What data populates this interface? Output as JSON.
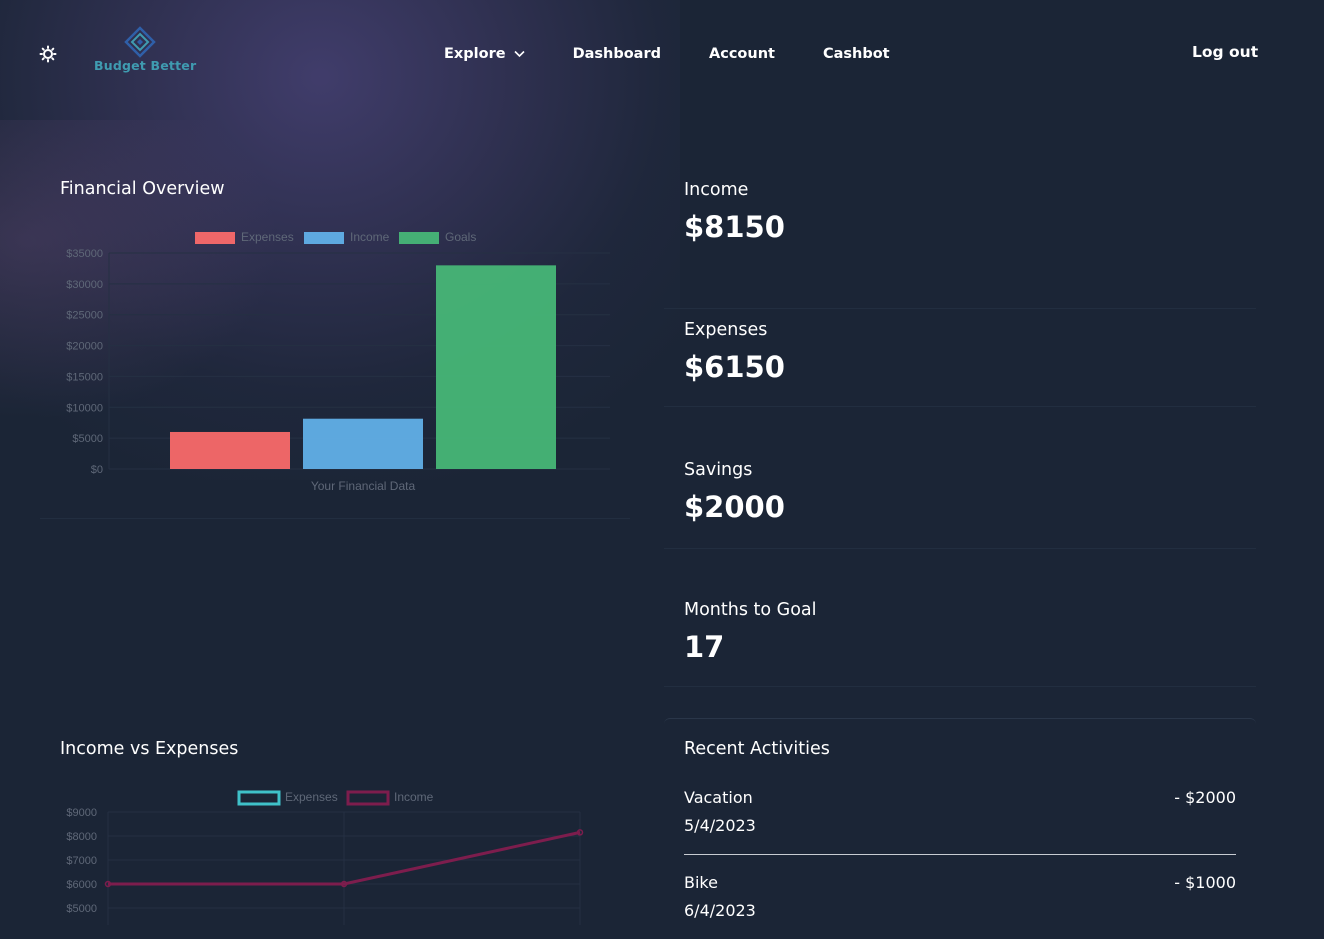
{
  "app": {
    "logo_text": "Budget Better"
  },
  "nav": {
    "explore": "Explore",
    "dashboard": "Dashboard",
    "account": "Account",
    "cashbot": "Cashbot",
    "logout": "Log out"
  },
  "financial_overview": {
    "title": "Financial Overview"
  },
  "income_vs_expenses": {
    "title": "Income vs Expenses"
  },
  "stats": {
    "income": {
      "label": "Income",
      "value": "$8150"
    },
    "expenses": {
      "label": "Expenses",
      "value": "$6150"
    },
    "savings": {
      "label": "Savings",
      "value": "$2000"
    },
    "months": {
      "label": "Months to Goal",
      "value": "17"
    }
  },
  "recent_activities": {
    "title": "Recent Activities",
    "items": [
      {
        "name": "Vacation",
        "date": "5/4/2023",
        "amount": "- $2000"
      },
      {
        "name": "Bike",
        "date": "6/4/2023",
        "amount": "- $1000"
      }
    ]
  },
  "chart_data": [
    {
      "type": "bar",
      "xlabel": "Your Financial Data",
      "ylim": [
        0,
        35000
      ],
      "yticks": [
        "$35000",
        "$30000",
        "$25000",
        "$20000",
        "$15000",
        "$10000",
        "$5000",
        "$0"
      ],
      "series": [
        {
          "name": "Expenses",
          "values": [
            6000
          ],
          "color": "#ff6b6b"
        },
        {
          "name": "Income",
          "values": [
            8150
          ],
          "color": "#63b3ed"
        },
        {
          "name": "Goals",
          "values": [
            33000
          ],
          "color": "#48bb78"
        }
      ],
      "legend": "top"
    },
    {
      "type": "line",
      "ylim": [
        5000,
        9000
      ],
      "yticks": [
        "$9000",
        "$8000",
        "$7000",
        "$6000",
        "$5000"
      ],
      "x": [
        1,
        2,
        3
      ],
      "series": [
        {
          "name": "Expenses",
          "values": [],
          "color": "#3fc1c9"
        },
        {
          "name": "Income",
          "values": [
            6000,
            6000,
            8150
          ],
          "color": "#7d1d4d"
        }
      ],
      "legend": "top"
    }
  ]
}
